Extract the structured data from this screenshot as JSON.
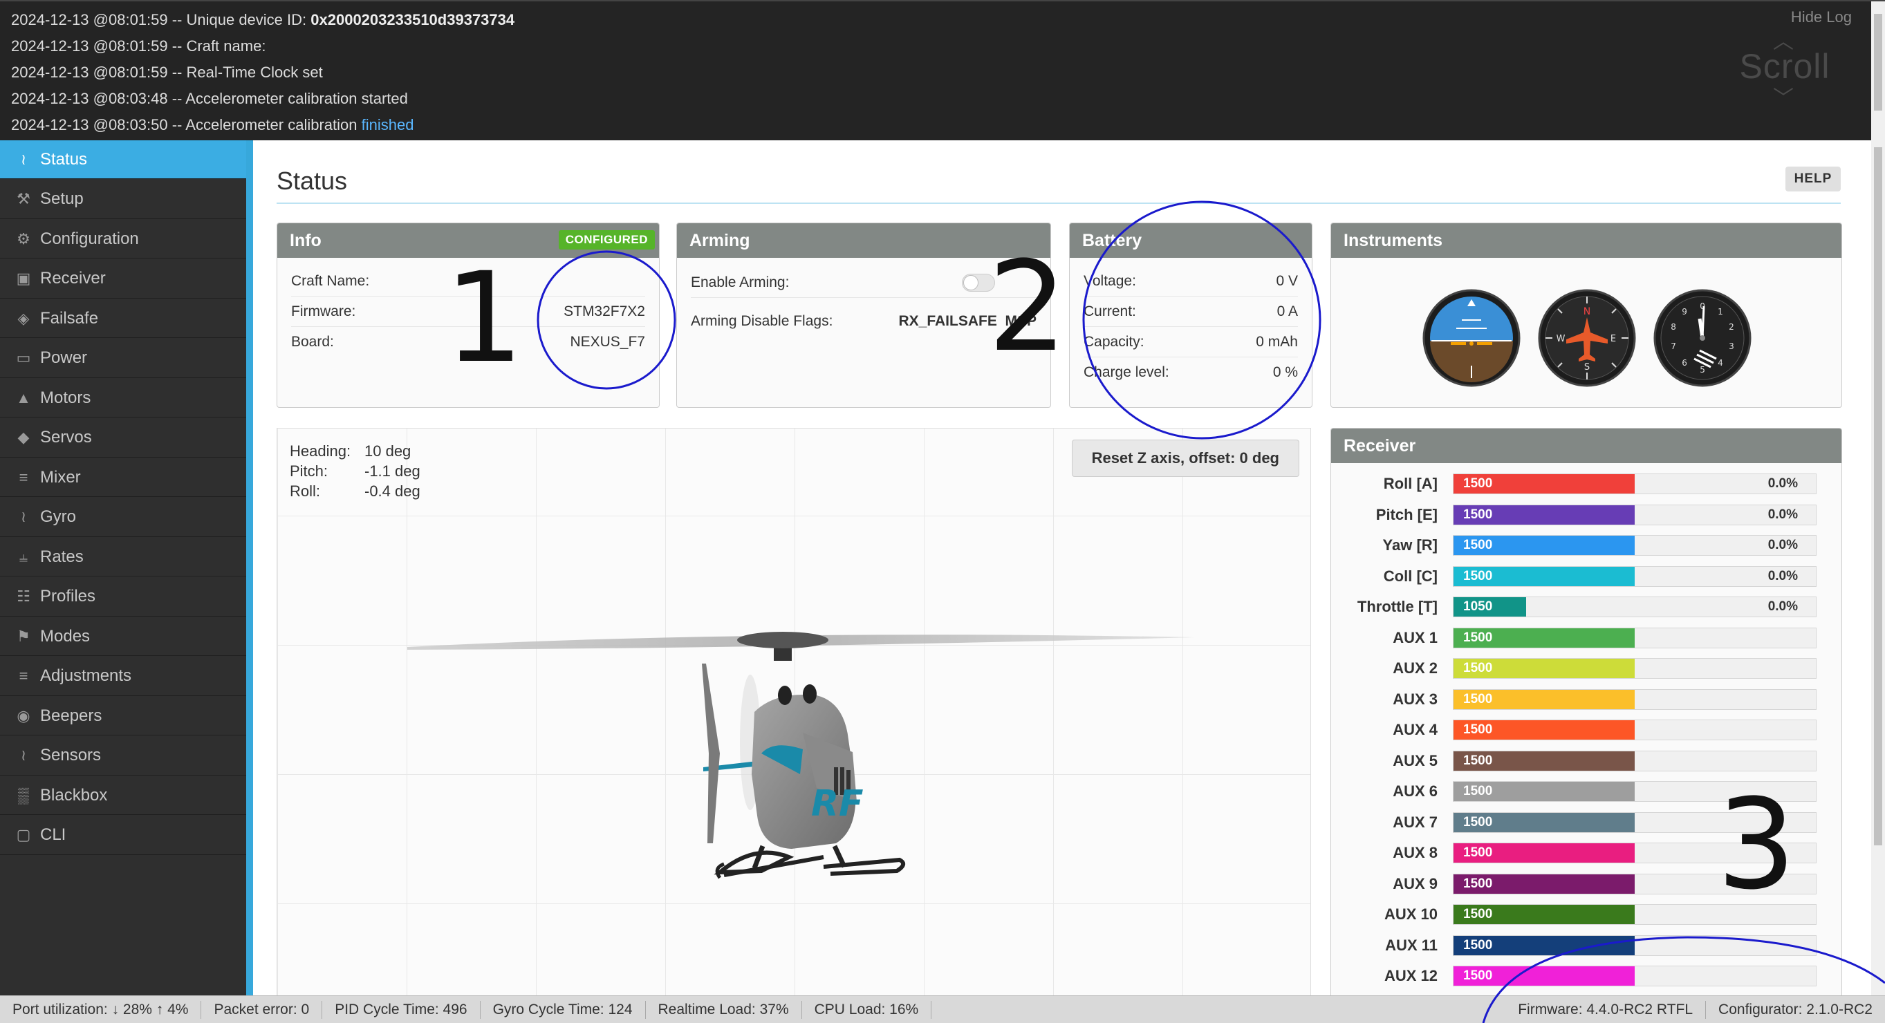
{
  "log": {
    "lines": [
      {
        "prefix": "2024-12-13 @08:01:59 -- Unique device ID: ",
        "bold": "0x2000203233510d39373734",
        "suffix": ""
      },
      {
        "prefix": "2024-12-13 @08:01:59 -- Craft name:",
        "bold": "",
        "suffix": ""
      },
      {
        "prefix": "2024-12-13 @08:01:59 -- Real-Time Clock set",
        "bold": "",
        "suffix": ""
      },
      {
        "prefix": "2024-12-13 @08:03:48 -- Accelerometer calibration started",
        "bold": "",
        "suffix": ""
      },
      {
        "prefix": "2024-12-13 @08:03:50 -- Accelerometer calibration ",
        "bold": "",
        "suffix": "finished"
      }
    ],
    "hide_label": "Hide Log",
    "scroll_label": "Scroll"
  },
  "sidebar": {
    "items": [
      {
        "label": "Status",
        "icon": "pulse-icon",
        "active": true
      },
      {
        "label": "Setup",
        "icon": "wrench-icon"
      },
      {
        "label": "Configuration",
        "icon": "gear-icon"
      },
      {
        "label": "Receiver",
        "icon": "robot-icon"
      },
      {
        "label": "Failsafe",
        "icon": "shield-icon"
      },
      {
        "label": "Power",
        "icon": "battery-icon"
      },
      {
        "label": "Motors",
        "icon": "motor-icon"
      },
      {
        "label": "Servos",
        "icon": "servo-icon"
      },
      {
        "label": "Mixer",
        "icon": "sliders-icon"
      },
      {
        "label": "Gyro",
        "icon": "pulse-icon"
      },
      {
        "label": "Rates",
        "icon": "tree-icon"
      },
      {
        "label": "Profiles",
        "icon": "sitemap-icon"
      },
      {
        "label": "Modes",
        "icon": "flag-icon"
      },
      {
        "label": "Adjustments",
        "icon": "sliders-icon"
      },
      {
        "label": "Beepers",
        "icon": "speaker-icon"
      },
      {
        "label": "Sensors",
        "icon": "pulse-icon"
      },
      {
        "label": "Blackbox",
        "icon": "chip-icon"
      },
      {
        "label": "CLI",
        "icon": "terminal-icon"
      }
    ]
  },
  "page": {
    "title": "Status",
    "help": "HELP"
  },
  "info": {
    "title": "Info",
    "badge": "CONFIGURED",
    "rows": [
      {
        "label": "Craft Name:",
        "value": ""
      },
      {
        "label": "Firmware:",
        "value": "STM32F7X2"
      },
      {
        "label": "Board:",
        "value": "NEXUS_F7"
      }
    ]
  },
  "arming": {
    "title": "Arming",
    "enable_label": "Enable Arming:",
    "flags_label": "Arming Disable Flags:",
    "flags_value": "RX_FAILSAFE  MSP"
  },
  "battery": {
    "title": "Battery",
    "rows": [
      {
        "label": "Voltage:",
        "value": "0 V"
      },
      {
        "label": "Current:",
        "value": "0 A"
      },
      {
        "label": "Capacity:",
        "value": "0 mAh"
      },
      {
        "label": "Charge level:",
        "value": "0 %"
      }
    ]
  },
  "instruments": {
    "title": "Instruments"
  },
  "attitude": {
    "rows": [
      {
        "label": "Heading:",
        "value": "10 deg"
      },
      {
        "label": "Pitch:",
        "value": "-1.1 deg"
      },
      {
        "label": "Roll:",
        "value": "-0.4 deg"
      }
    ],
    "reset_label": "Reset Z axis, offset: 0 deg"
  },
  "receiver": {
    "title": "Receiver",
    "channels": [
      {
        "label": "Roll [A]",
        "value": "1500",
        "fill": 0.5,
        "pct": "0.0%",
        "color": "#f0403a"
      },
      {
        "label": "Pitch [E]",
        "value": "1500",
        "fill": 0.5,
        "pct": "0.0%",
        "color": "#673db5"
      },
      {
        "label": "Yaw [R]",
        "value": "1500",
        "fill": 0.5,
        "pct": "0.0%",
        "color": "#2b96f0"
      },
      {
        "label": "Coll [C]",
        "value": "1500",
        "fill": 0.5,
        "pct": "0.0%",
        "color": "#1bbcd2"
      },
      {
        "label": "Throttle [T]",
        "value": "1050",
        "fill": 0.2,
        "pct": "0.0%",
        "color": "#119488"
      },
      {
        "label": "AUX 1",
        "value": "1500",
        "fill": 0.5,
        "pct": "",
        "color": "#4caf50"
      },
      {
        "label": "AUX 2",
        "value": "1500",
        "fill": 0.5,
        "pct": "",
        "color": "#cddc39"
      },
      {
        "label": "AUX 3",
        "value": "1500",
        "fill": 0.5,
        "pct": "",
        "color": "#fbbf2a"
      },
      {
        "label": "AUX 4",
        "value": "1500",
        "fill": 0.5,
        "pct": "",
        "color": "#fd5626"
      },
      {
        "label": "AUX 5",
        "value": "1500",
        "fill": 0.5,
        "pct": "",
        "color": "#795549"
      },
      {
        "label": "AUX 6",
        "value": "1500",
        "fill": 0.5,
        "pct": "",
        "color": "#9e9e9e"
      },
      {
        "label": "AUX 7",
        "value": "1500",
        "fill": 0.5,
        "pct": "",
        "color": "#607d8b"
      },
      {
        "label": "AUX 8",
        "value": "1500",
        "fill": 0.5,
        "pct": "",
        "color": "#e91e80"
      },
      {
        "label": "AUX 9",
        "value": "1500",
        "fill": 0.5,
        "pct": "",
        "color": "#7b1b6b"
      },
      {
        "label": "AUX 10",
        "value": "1500",
        "fill": 0.5,
        "pct": "",
        "color": "#3a7a1c"
      },
      {
        "label": "AUX 11",
        "value": "1500",
        "fill": 0.5,
        "pct": "",
        "color": "#143f7a"
      },
      {
        "label": "AUX 12",
        "value": "1500",
        "fill": 0.5,
        "pct": "",
        "color": "#f021d8"
      }
    ]
  },
  "annotations": {
    "one": "1",
    "two": "2",
    "three": "3"
  },
  "status_bar": {
    "port": "Port utilization: ↓ 28% ↑ 4%",
    "packet": "Packet error: 0",
    "pid": "PID Cycle Time: 496",
    "gyro": "Gyro Cycle Time: 124",
    "realtime": "Realtime Load: 37%",
    "cpu": "CPU Load: 16%",
    "firmware": "Firmware: 4.4.0-RC2 RTFL",
    "configurator": "Configurator: 2.1.0-RC2"
  },
  "colors": {
    "accent": "#3bade3",
    "badge": "#56b429",
    "panel_header": "#828885",
    "annotation": "#1a1acc"
  }
}
